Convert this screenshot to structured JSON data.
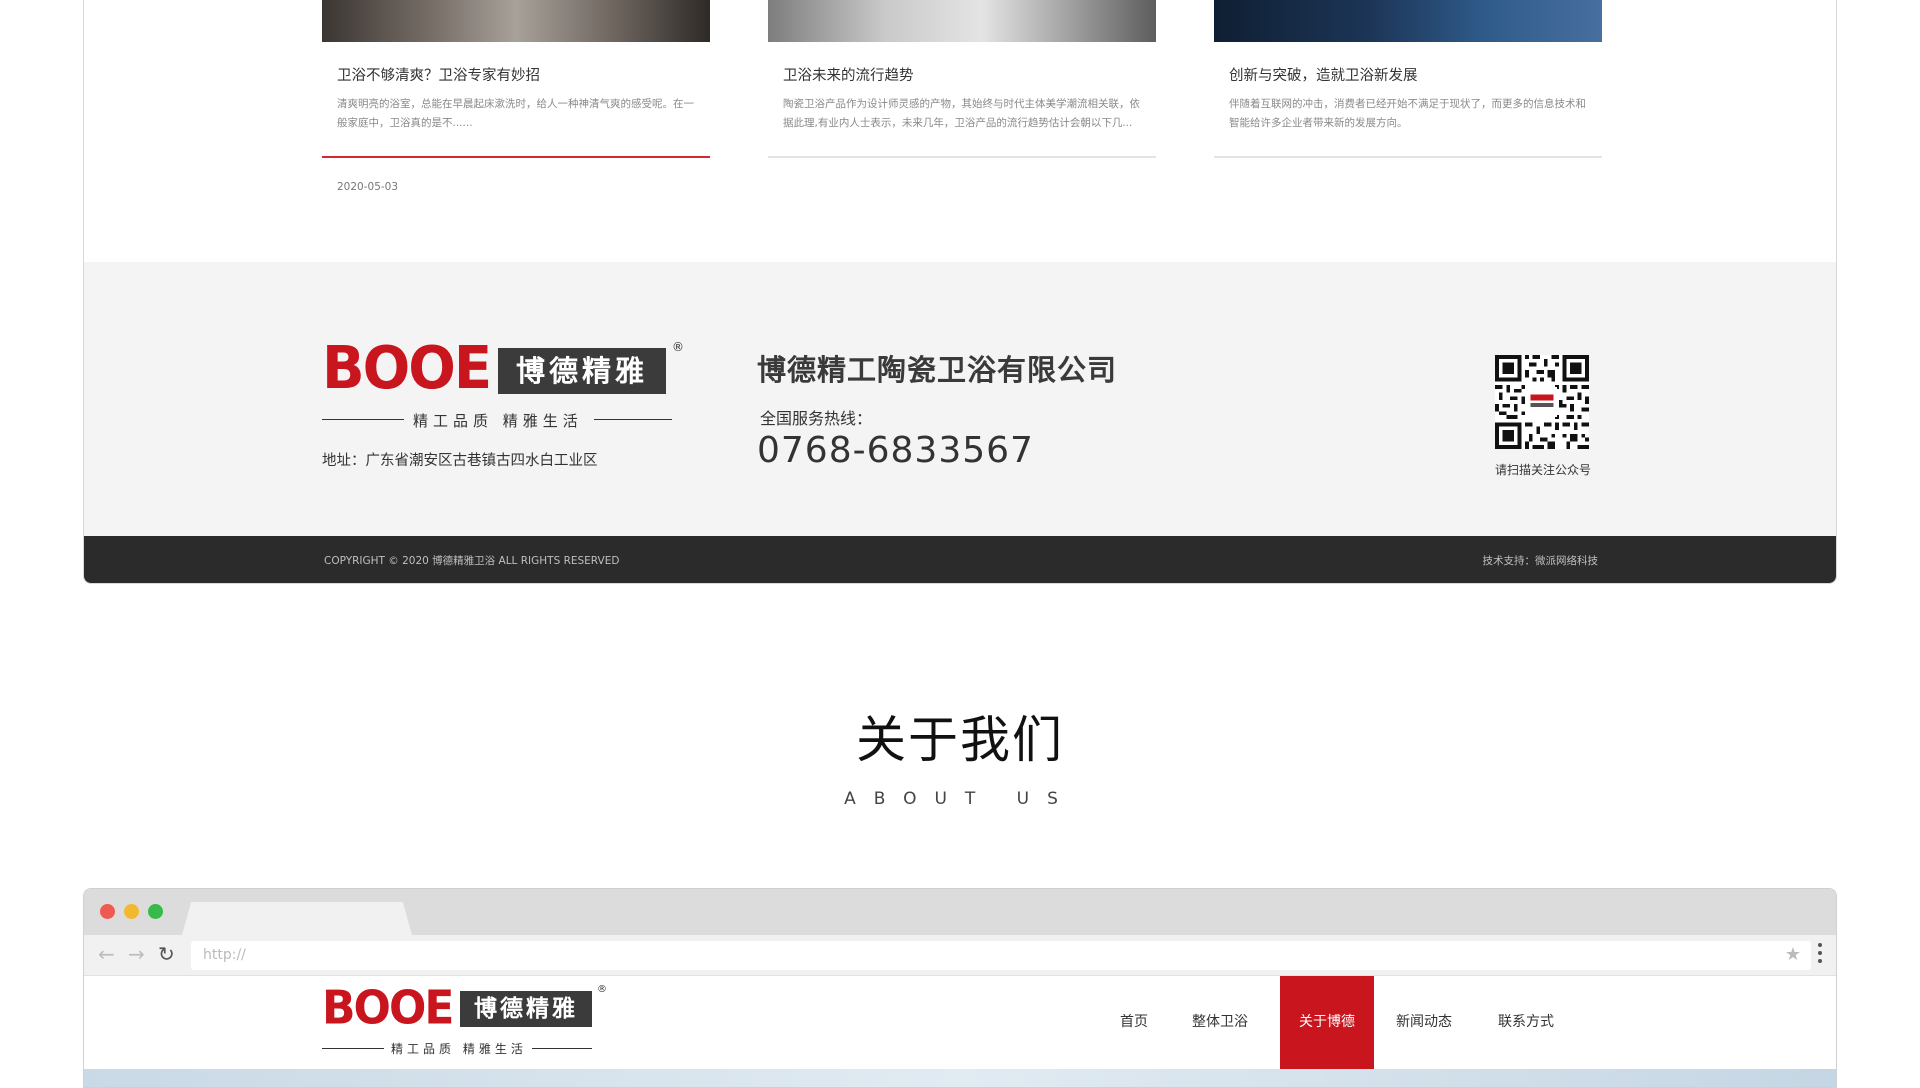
{
  "news": [
    {
      "title": "卫浴不够清爽？卫浴专家有妙招",
      "desc": "清爽明亮的浴室，总能在早晨起床漱洗时，给人一种神清气爽的感受呢。在一般家庭中，卫浴真的是不......",
      "date": "2020-05-03"
    },
    {
      "title": "卫浴未来的流行趋势",
      "desc": "陶瓷卫浴产品作为设计师灵感的产物，其始终与时代主体美学潮流相关联，依据此理,有业内人士表示，未来几年，卫浴产品的流行趋势估计会朝以下几...",
      "date": ""
    },
    {
      "title": "创新与突破，造就卫浴新发展",
      "desc": "伴随着互联网的冲击，消费者已经开始不满足于现状了，而更多的信息技术和智能给许多企业者带来新的发展方向。",
      "date": ""
    }
  ],
  "logo": {
    "brand_en": "BOOE",
    "brand_cn": "博德精雅",
    "registered": "®",
    "slogan": "精工品质 精雅生活"
  },
  "footer": {
    "address": "地址：广东省潮安区古巷镇古四水白工业区",
    "company": "博德精工陶瓷卫浴有限公司",
    "hotline_label": "全国服务热线：",
    "hotline_number": "0768-6833567",
    "qr_caption": "请扫描关注公众号",
    "copyright": "COPYRIGHT © 2020 博德精雅卫浴 ALL RIGHTS RESERVED",
    "tech_support": "技术支持：微派网络科技"
  },
  "about": {
    "title_cn": "关于我们",
    "title_en": "ABOUT US"
  },
  "browser": {
    "url": "http://"
  },
  "site_nav": [
    {
      "label": "首页"
    },
    {
      "label": "整体卫浴"
    },
    {
      "label": "关于博德"
    },
    {
      "label": "新闻动态"
    },
    {
      "label": "联系方式"
    }
  ],
  "colors": {
    "brand_red": "#c9151e",
    "footer_grey": "#f4f4f4",
    "footer_dark": "#2b2b2b",
    "active_underline": "#d6262f"
  },
  "icons": {
    "back": "arrow-left-icon",
    "forward": "arrow-right-icon",
    "reload": "reload-icon",
    "bookmark": "star-icon",
    "menu": "vertical-dots-icon"
  }
}
